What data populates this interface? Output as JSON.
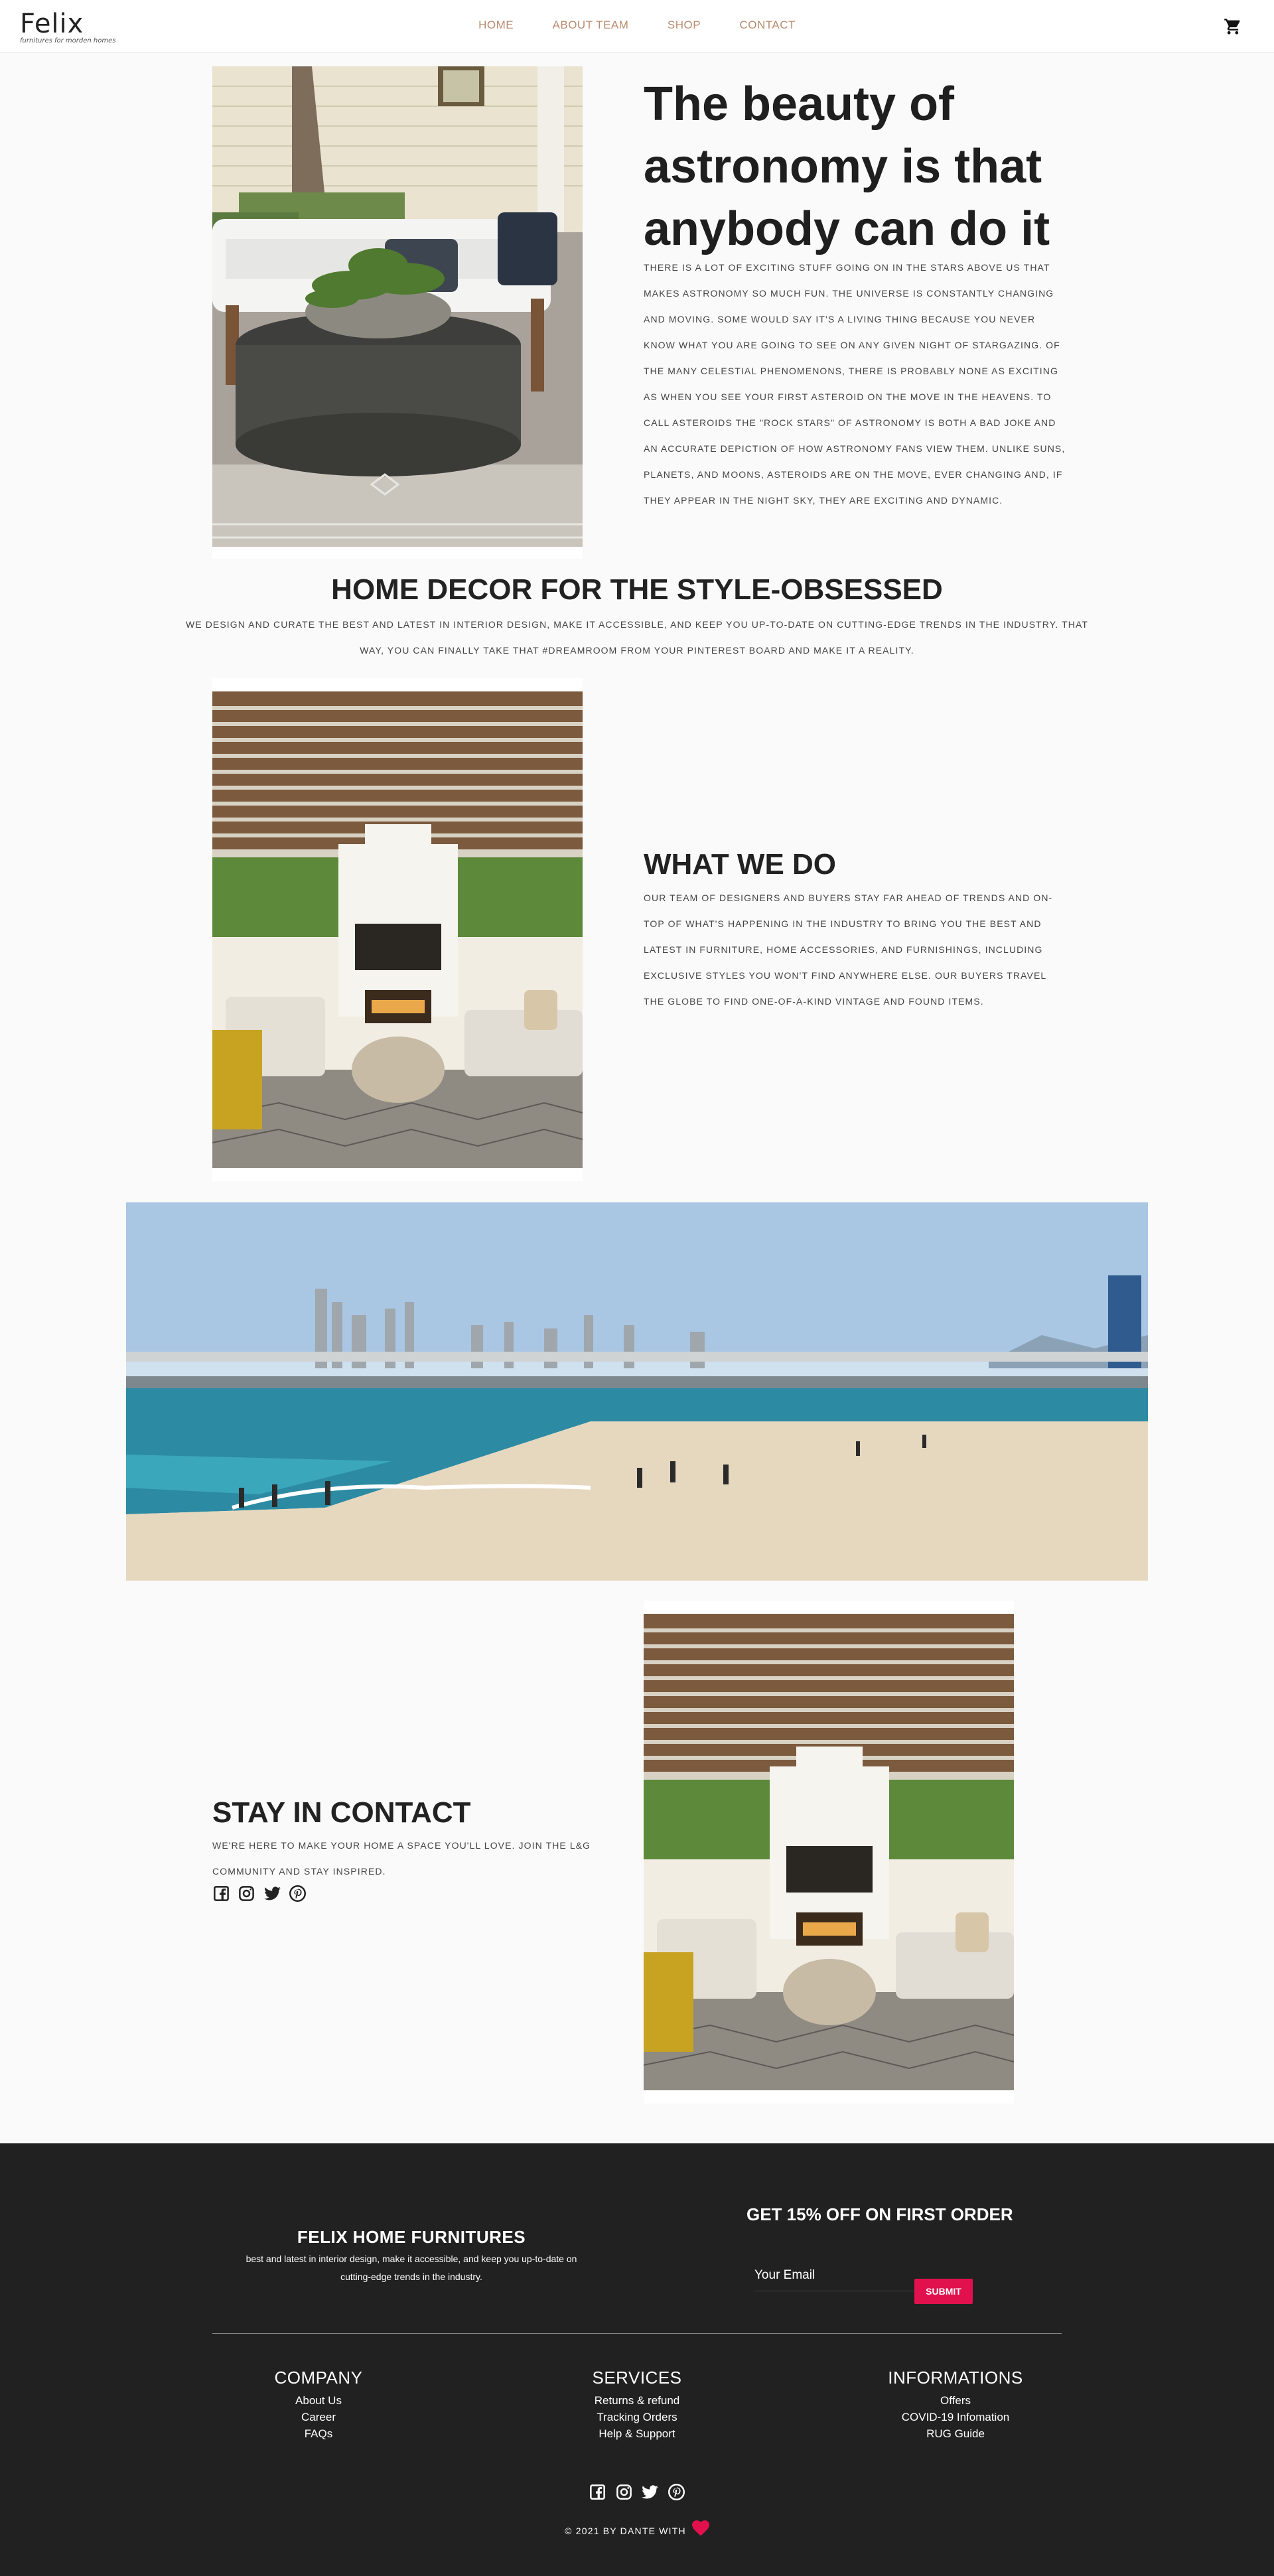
{
  "header": {
    "logo_text": "Felix",
    "tagline": "furnitures for morden homes",
    "nav": [
      "HOME",
      "ABOUT TEAM",
      "SHOP",
      "CONTACT"
    ],
    "cart_icon": "shopping-cart-icon"
  },
  "hero": {
    "heading": "The beauty of astronomy is that anybody can do it",
    "text": "THERE IS A LOT OF EXCITING STUFF GOING ON IN THE STARS ABOVE US THAT MAKES ASTRONOMY SO MUCH FUN. THE UNIVERSE IS CONSTANTLY CHANGING AND MOVING. SOME WOULD SAY IT'S A LIVING THING BECAUSE YOU NEVER KNOW WHAT YOU ARE GOING TO SEE ON ANY GIVEN NIGHT OF STARGAZING. OF THE MANY CELESTIAL PHENOMENONS, THERE IS PROBABLY NONE AS EXCITING AS WHEN YOU SEE YOUR FIRST ASTEROID ON THE MOVE IN THE HEAVENS. TO CALL ASTEROIDS THE \"ROCK STARS\" OF ASTRONOMY IS BOTH A BAD JOKE AND AN ACCURATE DEPICTION OF HOW ASTRONOMY FANS VIEW THEM. UNLIKE SUNS, PLANETS, AND MOONS, ASTEROIDS ARE ON THE MOVE, EVER CHANGING AND, IF THEY APPEAR IN THE NIGHT SKY, THEY ARE EXCITING AND DYNAMIC."
  },
  "decor": {
    "heading": "HOME DECOR FOR THE STYLE-OBSESSED",
    "text": "WE DESIGN AND CURATE THE BEST AND LATEST IN INTERIOR DESIGN, MAKE IT ACCESSIBLE, AND KEEP YOU UP-TO-DATE ON CUTTING-EDGE TRENDS IN THE INDUSTRY. THAT WAY, YOU CAN FINALLY TAKE THAT #DREAMROOM FROM YOUR PINTEREST BOARD AND MAKE IT A REALITY."
  },
  "what_we_do": {
    "heading": "WHAT WE DO",
    "text": "OUR TEAM OF DESIGNERS AND BUYERS STAY FAR AHEAD OF TRENDS AND ON-TOP OF WHAT'S HAPPENING IN THE INDUSTRY TO BRING YOU THE BEST AND LATEST IN FURNITURE, HOME ACCESSORIES, AND FURNISHINGS, INCLUDING EXCLUSIVE STYLES YOU WON'T FIND ANYWHERE ELSE. OUR BUYERS TRAVEL THE GLOBE TO FIND ONE-OF-A-KIND VINTAGE AND FOUND ITEMS."
  },
  "contact": {
    "heading": "STAY IN CONTACT",
    "text": "WE'RE HERE TO MAKE YOUR HOME A SPACE YOU'LL LOVE. JOIN THE L&G COMMUNITY AND STAY INSPIRED.",
    "social_icons": [
      "facebook-icon",
      "instagram-icon",
      "twitter-icon",
      "pinterest-icon"
    ]
  },
  "footer": {
    "brand_title": "FELIX HOME FURNITURES",
    "brand_text": "best and latest in interior design, make it accessible, and keep you up-to-date on cutting-edge trends in the industry.",
    "offer_title": "GET 15% OFF ON FIRST ORDER",
    "email_placeholder": "Your Email",
    "submit_label": "SUBMIT",
    "columns": [
      {
        "title": "COMPANY",
        "links": [
          "About Us",
          "Career",
          "FAQs"
        ]
      },
      {
        "title": "SERVICES",
        "links": [
          "Returns & refund",
          "Tracking Orders",
          "Help & Support"
        ]
      },
      {
        "title": "INFORMATIONS",
        "links": [
          "Offers",
          "COVID-19 Infomation",
          "RUG Guide"
        ]
      }
    ],
    "copyright": "© 2021 BY DANTE WITH",
    "heart_icon": "heart-icon"
  },
  "colors": {
    "nav_text": "#b98a6f",
    "footer_bg": "#212121",
    "submit_bg": "#e0114d",
    "page_bg": "#fafafa"
  }
}
